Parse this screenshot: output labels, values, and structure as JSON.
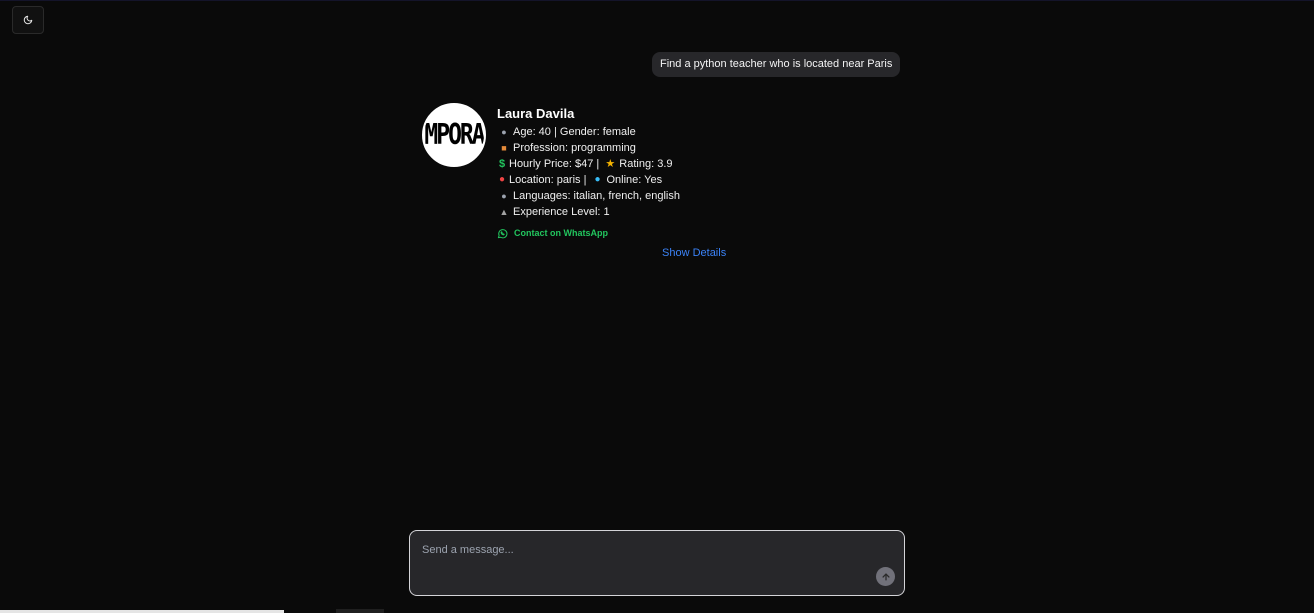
{
  "header": {
    "theme_toggle_icon": "moon-icon"
  },
  "chat": {
    "user_message": "Find a python teacher who is located near Paris",
    "result": {
      "avatar_text": "MPORA",
      "name": "Laura Davila",
      "age_label": "Age: 40 | Gender: female",
      "profession_label": "Profession: programming",
      "price_label": "Hourly Price: $47 |",
      "rating_label": "Rating: 3.9",
      "location_label": "Location: paris |",
      "online_label": "Online: Yes",
      "languages_label": "Languages: italian, french, english",
      "experience_label": "Experience Level: 1",
      "whatsapp_label": "Contact on WhatsApp",
      "show_details_label": "Show Details",
      "icons": {
        "age": "person-icon",
        "profession": "books-icon",
        "price": "dollar-icon",
        "rating": "star-icon",
        "location": "pin-icon",
        "online": "globe-icon",
        "languages": "speaker-icon",
        "experience": "graduation-cap-icon",
        "whatsapp": "whatsapp-icon"
      }
    }
  },
  "composer": {
    "placeholder": "Send a message...",
    "send_icon": "arrow-up-icon"
  },
  "colors": {
    "background": "#0a0a0a",
    "bubble": "#27272a",
    "link_blue": "#3b82f6",
    "whatsapp_green": "#22c55e"
  },
  "page_progress": 0.216
}
